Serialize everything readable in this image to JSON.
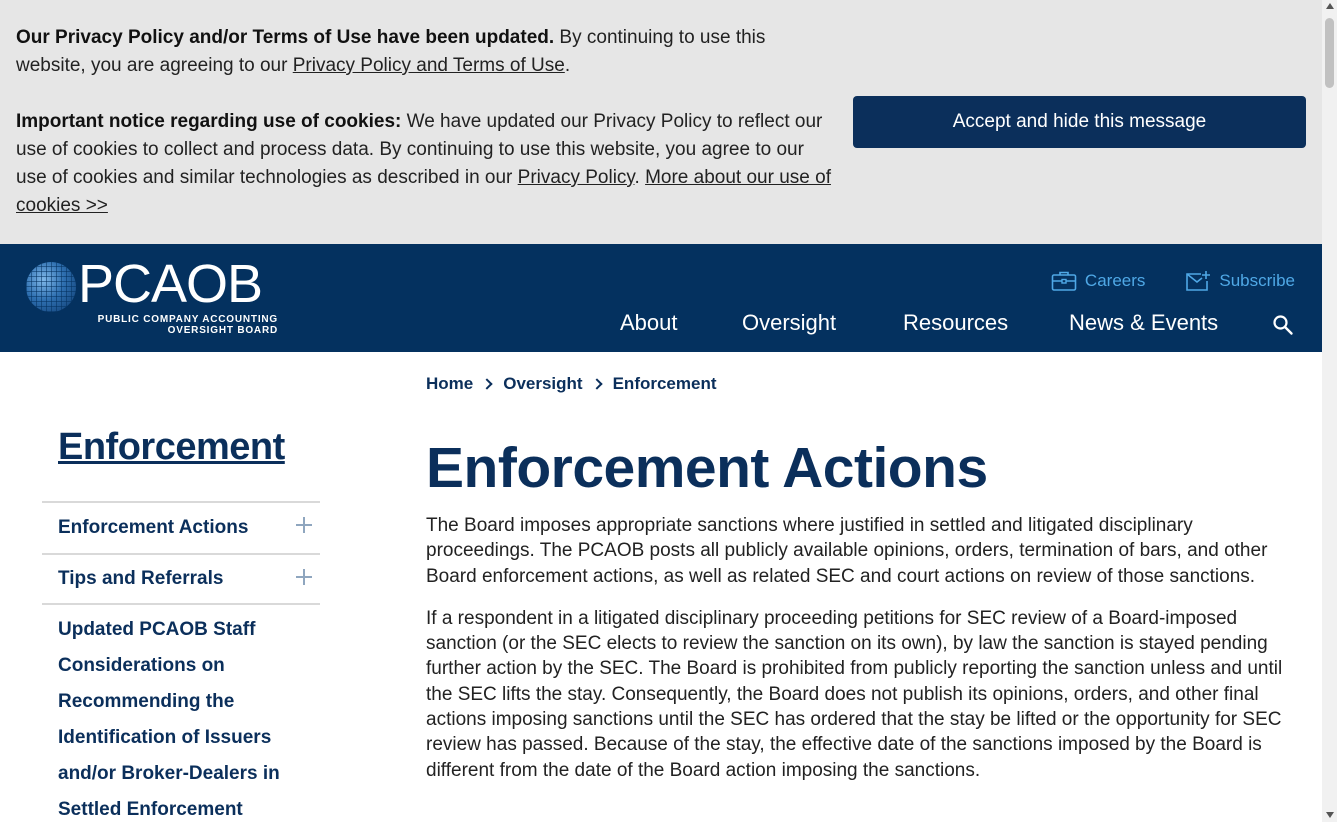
{
  "cookie_banner": {
    "notice1_bold": "Our Privacy Policy and/or Terms of Use have been updated.",
    "notice1_text": " By continuing to use this website, you are agreeing to our ",
    "notice1_link": "Privacy Policy and Terms of Use",
    "notice1_end": ".",
    "notice2_bold": "Important notice regarding use of cookies:",
    "notice2_text": " We have updated our Privacy Policy to reflect our use of cookies to collect and process data. By continuing to use this website, you agree to our use of cookies and similar technologies as described in our ",
    "notice2_link1": "Privacy Policy",
    "notice2_sep": ". ",
    "notice2_link2": "More about our use of cookies >>",
    "accept_label": "Accept and hide this message"
  },
  "header": {
    "logo_word": "PCAOB",
    "logo_sub_line1": "PUBLIC COMPANY ACCOUNTING",
    "logo_sub_line2": "OVERSIGHT BOARD",
    "util_links": [
      {
        "label": "Careers",
        "icon": "briefcase-icon"
      },
      {
        "label": "Subscribe",
        "icon": "mail-plus-icon"
      }
    ],
    "nav": [
      "About",
      "Oversight",
      "Resources",
      "News & Events"
    ],
    "search_icon": "search-icon",
    "colors": {
      "background": "#04315f",
      "link": "#4fa8e6"
    }
  },
  "breadcrumb": [
    "Home",
    "Oversight",
    "Enforcement"
  ],
  "sidebar": {
    "title": "Enforcement",
    "items": [
      {
        "label": "Enforcement Actions",
        "icon": "plus-icon"
      },
      {
        "label": "Tips and Referrals",
        "icon": "plus-icon"
      }
    ],
    "long_item": "Updated PCAOB Staff Considerations on Recommending the Identification of Issuers and/or Broker-Dealers in Settled Enforcement"
  },
  "main": {
    "title": "Enforcement Actions",
    "paragraph1": "The Board imposes appropriate sanctions where justified in settled and litigated disciplinary proceedings. The PCAOB posts all publicly available opinions, orders, termination of bars, and other Board enforcement actions, as well as related SEC and court actions on review of those sanctions.",
    "paragraph2": "If a respondent in a litigated disciplinary proceeding petitions for SEC review of a Board-imposed sanction (or the SEC elects to review the sanction on its own), by law the sanction is stayed pending further action by the SEC. The Board is prohibited from publicly reporting the sanction unless and until the SEC lifts the stay. Consequently, the Board does not publish its opinions, orders, and other final actions imposing sanctions until the SEC has ordered that the stay be lifted or the opportunity for SEC review has passed. Because of the stay, the effective date of the sanctions imposed by the Board is different from the date of the Board action imposing the sanctions."
  },
  "colors": {
    "navy": "#0b2f5b",
    "banner_bg": "#e6e6e6"
  }
}
